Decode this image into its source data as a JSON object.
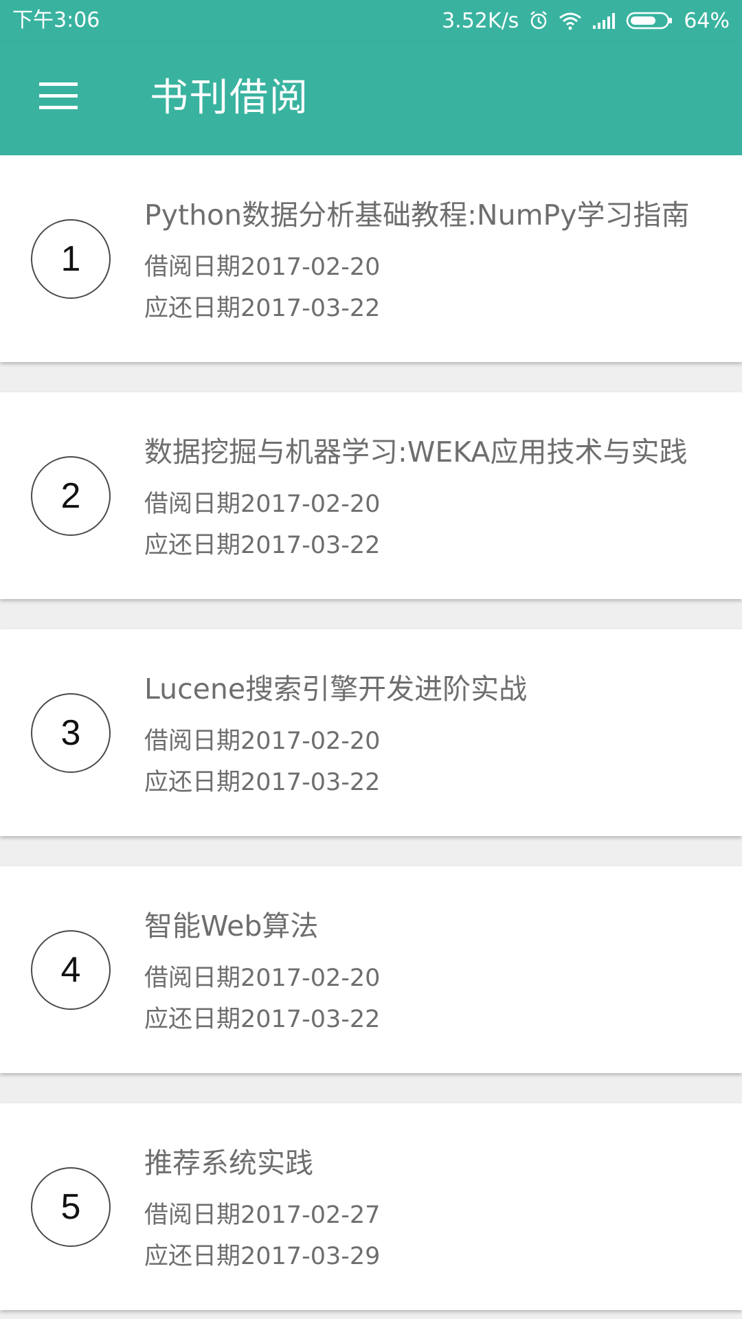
{
  "status_bar": {
    "time": "下午3:06",
    "network_speed": "3.52K/s",
    "battery": "64%",
    "icons": [
      "alarm-icon",
      "wifi-icon",
      "signal-icon",
      "battery-icon"
    ]
  },
  "app_bar": {
    "title": "书刊借阅",
    "menu_icon": "hamburger-menu-icon",
    "background_color": "#39b3a0"
  },
  "books": [
    {
      "index": "1",
      "title": "Python数据分析基础教程:NumPy学习指南",
      "borrow": "借阅日期2017-02-20",
      "due": "应还日期2017-03-22"
    },
    {
      "index": "2",
      "title": "数据挖掘与机器学习:WEKA应用技术与实践",
      "borrow": "借阅日期2017-02-20",
      "due": "应还日期2017-03-22"
    },
    {
      "index": "3",
      "title": "Lucene搜索引擎开发进阶实战",
      "borrow": "借阅日期2017-02-20",
      "due": "应还日期2017-03-22"
    },
    {
      "index": "4",
      "title": "智能Web算法",
      "borrow": "借阅日期2017-02-20",
      "due": "应还日期2017-03-22"
    },
    {
      "index": "5",
      "title": "推荐系统实践",
      "borrow": "借阅日期2017-02-27",
      "due": "应还日期2017-03-29"
    }
  ]
}
